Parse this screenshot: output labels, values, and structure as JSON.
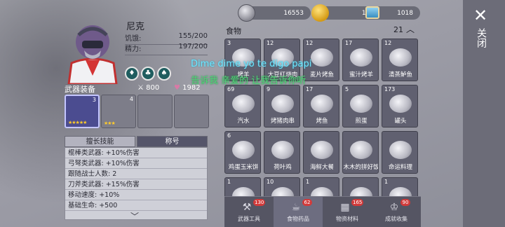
{
  "resources": [
    {
      "icon": "silver-coin-icon",
      "value": "16553"
    },
    {
      "icon": "gold-coin-icon",
      "value": "122"
    },
    {
      "icon": "ticket-icon",
      "value": "1018"
    }
  ],
  "close": {
    "label": "关闭",
    "icon": "close-icon"
  },
  "character": {
    "name": "尼克",
    "stats": [
      {
        "label": "饥饿:",
        "value": "155/200"
      },
      {
        "label": "精力:",
        "value": "197/200"
      }
    ],
    "traits": [
      "trait-1-icon",
      "trait-2-icon",
      "trait-3-icon"
    ]
  },
  "equipment": {
    "title": "武器装备",
    "attack": "800",
    "health": "1982",
    "slots": [
      {
        "num": "3",
        "stars": "★★★★★",
        "selected": true
      },
      {
        "num": "4",
        "stars": "★★★",
        "selected": false
      },
      {
        "num": "",
        "stars": "",
        "selected": false
      },
      {
        "num": "",
        "stars": "",
        "selected": false
      }
    ]
  },
  "skills": {
    "tabs": [
      "擅长技能",
      "称号"
    ],
    "rows": [
      "棍棒类武器: +10%伤害",
      "弓弩类武器: +10%伤害",
      "跟随战士人数: 2",
      "刀斧类武器: +15%伤害",
      "移动速度: +10%",
      "基础生命: +500"
    ]
  },
  "food": {
    "title": "食物",
    "count": "21",
    "items": [
      {
        "count": "3",
        "label": "烤羊"
      },
      {
        "count": "12",
        "label": "大豆红烧肉"
      },
      {
        "count": "12",
        "label": "麦片烤鱼"
      },
      {
        "count": "17",
        "label": "蜜汁烤羊"
      },
      {
        "count": "12",
        "label": "清蒸鲈鱼"
      },
      {
        "count": "69",
        "label": "汽水"
      },
      {
        "count": "9",
        "label": "烤猪肉串"
      },
      {
        "count": "17",
        "label": "烤鱼"
      },
      {
        "count": "5",
        "label": "煎蛋"
      },
      {
        "count": "173",
        "label": "罐头"
      },
      {
        "count": "6",
        "label": "鸡蛋玉米饼"
      },
      {
        "count": "",
        "label": "荷叶鸡"
      },
      {
        "count": "",
        "label": "海鲜大餐"
      },
      {
        "count": "",
        "label": "木木的拼好饭"
      },
      {
        "count": "",
        "label": "命运料理"
      },
      {
        "count": "1",
        "label": ""
      },
      {
        "count": "10",
        "label": ""
      },
      {
        "count": "1",
        "label": ""
      },
      {
        "count": "",
        "label": ""
      },
      {
        "count": "1",
        "label": ""
      }
    ]
  },
  "bottom_nav": [
    {
      "label": "武器工具",
      "badge": "130",
      "icon": "weapon-tool-icon",
      "active": false
    },
    {
      "label": "食物药品",
      "badge": "62",
      "icon": "food-medicine-icon",
      "active": true
    },
    {
      "label": "物资材料",
      "badge": "165",
      "icon": "material-icon",
      "active": false
    },
    {
      "label": "成就收集",
      "badge": "90",
      "icon": "trophy-icon",
      "active": false
    }
  ],
  "overlay": {
    "line1": "Dime dime yo te digo papi",
    "line2": "告诉我 亲爱的 让我告诉你听"
  },
  "colors": {
    "badge_red": "#d23a3a",
    "star_gold": "#ffcb2b",
    "overlay_cyan": "#6fe6ff",
    "overlay_green": "#52d47a"
  }
}
